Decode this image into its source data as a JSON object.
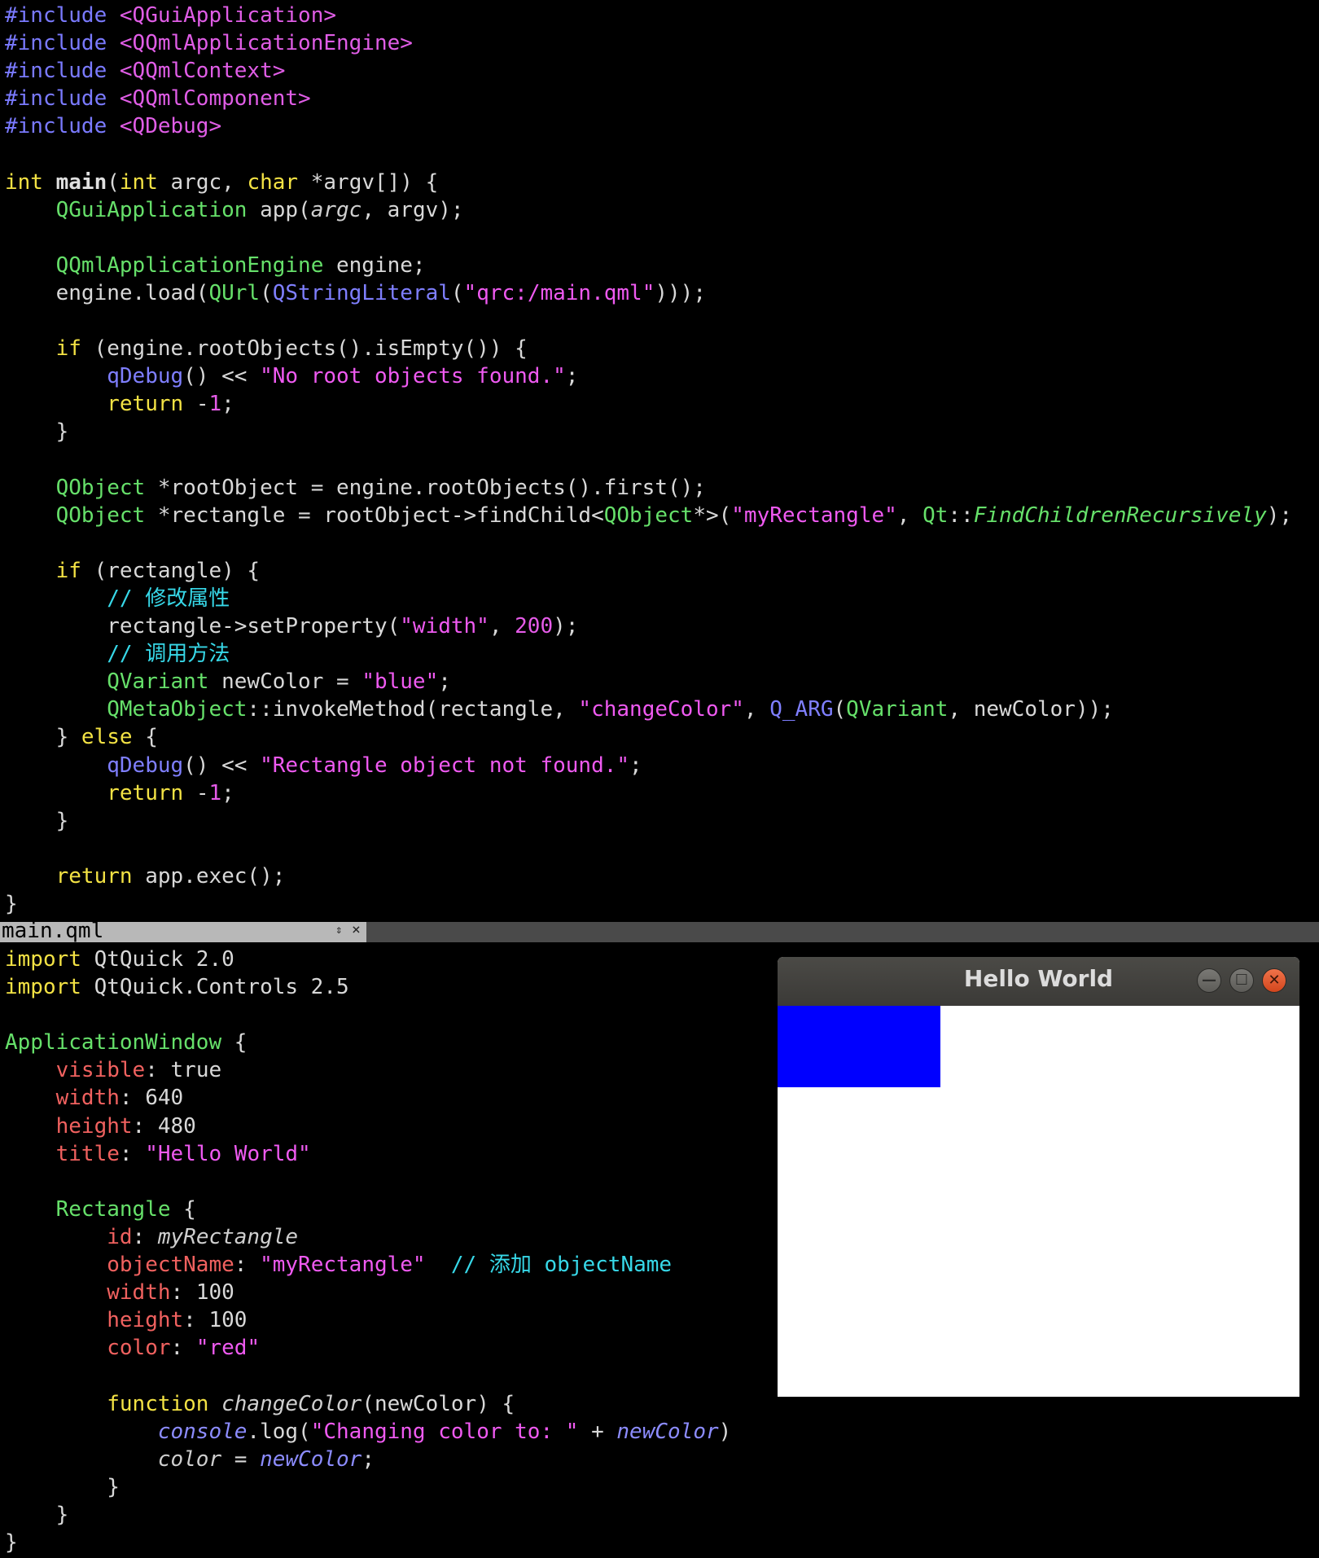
{
  "cpp_editor": {
    "lines": [
      [
        {
          "t": "#include ",
          "c": "macro"
        },
        {
          "t": "<QGuiApplication>",
          "c": "inc"
        }
      ],
      [
        {
          "t": "#include ",
          "c": "macro"
        },
        {
          "t": "<QQmlApplicationEngine>",
          "c": "inc"
        }
      ],
      [
        {
          "t": "#include ",
          "c": "macro"
        },
        {
          "t": "<QQmlContext>",
          "c": "inc"
        }
      ],
      [
        {
          "t": "#include ",
          "c": "macro"
        },
        {
          "t": "<QQmlComponent>",
          "c": "inc"
        }
      ],
      [
        {
          "t": "#include ",
          "c": "macro"
        },
        {
          "t": "<QDebug>",
          "c": "inc"
        }
      ],
      [],
      [
        {
          "t": "int ",
          "c": "kw"
        },
        {
          "t": "main",
          "c": "bold"
        },
        {
          "t": "(",
          "c": "plain"
        },
        {
          "t": "int ",
          "c": "kw"
        },
        {
          "t": "argc, ",
          "c": "plain"
        },
        {
          "t": "char ",
          "c": "kw"
        },
        {
          "t": "*argv[]) {",
          "c": "plain"
        }
      ],
      [
        {
          "t": "    ",
          "c": "plain"
        },
        {
          "t": "QGuiApplication ",
          "c": "type"
        },
        {
          "t": "app(",
          "c": "plain"
        },
        {
          "t": "argc",
          "c": "it"
        },
        {
          "t": ", argv);",
          "c": "plain"
        }
      ],
      [],
      [
        {
          "t": "    ",
          "c": "plain"
        },
        {
          "t": "QQmlApplicationEngine ",
          "c": "type"
        },
        {
          "t": "engine;",
          "c": "plain"
        }
      ],
      [
        {
          "t": "    engine.load(",
          "c": "plain"
        },
        {
          "t": "QUrl",
          "c": "type"
        },
        {
          "t": "(",
          "c": "plain"
        },
        {
          "t": "QStringLiteral",
          "c": "fnb"
        },
        {
          "t": "(",
          "c": "plain"
        },
        {
          "t": "\"qrc:/main.qml\"",
          "c": "str"
        },
        {
          "t": ")));",
          "c": "plain"
        }
      ],
      [],
      [
        {
          "t": "    ",
          "c": "plain"
        },
        {
          "t": "if ",
          "c": "kw"
        },
        {
          "t": "(engine.rootObjects().isEmpty()) {",
          "c": "plain"
        }
      ],
      [
        {
          "t": "        ",
          "c": "plain"
        },
        {
          "t": "qDebug",
          "c": "fnb"
        },
        {
          "t": "() << ",
          "c": "plain"
        },
        {
          "t": "\"No root objects found.\"",
          "c": "str"
        },
        {
          "t": ";",
          "c": "plain"
        }
      ],
      [
        {
          "t": "        ",
          "c": "plain"
        },
        {
          "t": "return ",
          "c": "kw"
        },
        {
          "t": "-",
          "c": "plain"
        },
        {
          "t": "1",
          "c": "num"
        },
        {
          "t": ";",
          "c": "plain"
        }
      ],
      [
        {
          "t": "    }",
          "c": "plain"
        }
      ],
      [],
      [
        {
          "t": "    ",
          "c": "plain"
        },
        {
          "t": "QObject ",
          "c": "type"
        },
        {
          "t": "*rootObject = engine.rootObjects().first();",
          "c": "plain"
        }
      ],
      [
        {
          "t": "    ",
          "c": "plain"
        },
        {
          "t": "QObject ",
          "c": "type"
        },
        {
          "t": "*rectangle = rootObject->findChild<",
          "c": "plain"
        },
        {
          "t": "QObject",
          "c": "type"
        },
        {
          "t": "*>(",
          "c": "plain"
        },
        {
          "t": "\"myRectangle\"",
          "c": "str"
        },
        {
          "t": ", ",
          "c": "plain"
        },
        {
          "t": "Qt",
          "c": "type"
        },
        {
          "t": "::",
          "c": "plain"
        },
        {
          "t": "FindChildrenRecursively",
          "c": "itg"
        },
        {
          "t": ");",
          "c": "plain"
        }
      ],
      [],
      [
        {
          "t": "    ",
          "c": "plain"
        },
        {
          "t": "if ",
          "c": "kw"
        },
        {
          "t": "(rectangle) {",
          "c": "plain"
        }
      ],
      [
        {
          "t": "        ",
          "c": "plain"
        },
        {
          "t": "// 修改属性",
          "c": "com"
        }
      ],
      [
        {
          "t": "        rectangle->setProperty(",
          "c": "plain"
        },
        {
          "t": "\"width\"",
          "c": "str"
        },
        {
          "t": ", ",
          "c": "plain"
        },
        {
          "t": "200",
          "c": "num"
        },
        {
          "t": ");",
          "c": "plain"
        }
      ],
      [
        {
          "t": "        ",
          "c": "plain"
        },
        {
          "t": "// 调用方法",
          "c": "com"
        }
      ],
      [
        {
          "t": "        ",
          "c": "plain"
        },
        {
          "t": "QVariant ",
          "c": "type"
        },
        {
          "t": "newColor = ",
          "c": "plain"
        },
        {
          "t": "\"blue\"",
          "c": "str"
        },
        {
          "t": ";",
          "c": "plain"
        }
      ],
      [
        {
          "t": "        ",
          "c": "plain"
        },
        {
          "t": "QMetaObject",
          "c": "type"
        },
        {
          "t": "::invokeMethod(rectangle, ",
          "c": "plain"
        },
        {
          "t": "\"changeColor\"",
          "c": "str"
        },
        {
          "t": ", ",
          "c": "plain"
        },
        {
          "t": "Q_ARG",
          "c": "fnb"
        },
        {
          "t": "(",
          "c": "plain"
        },
        {
          "t": "QVariant",
          "c": "type"
        },
        {
          "t": ", newColor));",
          "c": "plain"
        }
      ],
      [
        {
          "t": "    } ",
          "c": "plain"
        },
        {
          "t": "else ",
          "c": "kw"
        },
        {
          "t": "{",
          "c": "plain"
        }
      ],
      [
        {
          "t": "        ",
          "c": "plain"
        },
        {
          "t": "qDebug",
          "c": "fnb"
        },
        {
          "t": "() << ",
          "c": "plain"
        },
        {
          "t": "\"Rectangle object not found.\"",
          "c": "str"
        },
        {
          "t": ";",
          "c": "plain"
        }
      ],
      [
        {
          "t": "        ",
          "c": "plain"
        },
        {
          "t": "return ",
          "c": "kw"
        },
        {
          "t": "-",
          "c": "plain"
        },
        {
          "t": "1",
          "c": "num"
        },
        {
          "t": ";",
          "c": "plain"
        }
      ],
      [
        {
          "t": "    }",
          "c": "plain"
        }
      ],
      [],
      [
        {
          "t": "    ",
          "c": "plain"
        },
        {
          "t": "return ",
          "c": "kw"
        },
        {
          "t": "app.exec();",
          "c": "plain"
        }
      ],
      [
        {
          "t": "}",
          "c": "plain"
        }
      ]
    ]
  },
  "tab": {
    "filename": "main.qml",
    "scroll_icon": "⇕",
    "close_icon": "×"
  },
  "qml_editor": {
    "lines": [
      [
        {
          "t": "import ",
          "c": "kw"
        },
        {
          "t": "QtQuick 2.0",
          "c": "plain"
        }
      ],
      [
        {
          "t": "import ",
          "c": "kw"
        },
        {
          "t": "QtQuick.Controls 2.5",
          "c": "plain"
        }
      ],
      [],
      [
        {
          "t": "ApplicationWindow ",
          "c": "type"
        },
        {
          "t": "{",
          "c": "plain"
        }
      ],
      [
        {
          "t": "    ",
          "c": "plain"
        },
        {
          "t": "visible",
          "c": "prop"
        },
        {
          "t": ": true",
          "c": "plain"
        }
      ],
      [
        {
          "t": "    ",
          "c": "plain"
        },
        {
          "t": "width",
          "c": "prop"
        },
        {
          "t": ": 640",
          "c": "plain"
        }
      ],
      [
        {
          "t": "    ",
          "c": "plain"
        },
        {
          "t": "height",
          "c": "prop"
        },
        {
          "t": ": 480",
          "c": "plain"
        }
      ],
      [
        {
          "t": "    ",
          "c": "plain"
        },
        {
          "t": "title",
          "c": "prop"
        },
        {
          "t": ": ",
          "c": "plain"
        },
        {
          "t": "\"Hello World\"",
          "c": "str"
        }
      ],
      [],
      [
        {
          "t": "    ",
          "c": "plain"
        },
        {
          "t": "Rectangle ",
          "c": "type"
        },
        {
          "t": "{",
          "c": "plain"
        }
      ],
      [
        {
          "t": "        ",
          "c": "plain"
        },
        {
          "t": "id",
          "c": "prop"
        },
        {
          "t": ": ",
          "c": "plain"
        },
        {
          "t": "myRectangle",
          "c": "id"
        }
      ],
      [
        {
          "t": "        ",
          "c": "plain"
        },
        {
          "t": "objectName",
          "c": "prop"
        },
        {
          "t": ": ",
          "c": "plain"
        },
        {
          "t": "\"myRectangle\"",
          "c": "str"
        },
        {
          "t": "  ",
          "c": "plain"
        },
        {
          "t": "// 添加 objectName",
          "c": "com"
        }
      ],
      [
        {
          "t": "        ",
          "c": "plain"
        },
        {
          "t": "width",
          "c": "prop"
        },
        {
          "t": ": 100",
          "c": "plain"
        }
      ],
      [
        {
          "t": "        ",
          "c": "plain"
        },
        {
          "t": "height",
          "c": "prop"
        },
        {
          "t": ": 100",
          "c": "plain"
        }
      ],
      [
        {
          "t": "        ",
          "c": "plain"
        },
        {
          "t": "color",
          "c": "prop"
        },
        {
          "t": ": ",
          "c": "plain"
        },
        {
          "t": "\"red\"",
          "c": "str"
        }
      ],
      [],
      [
        {
          "t": "        ",
          "c": "plain"
        },
        {
          "t": "function ",
          "c": "kw"
        },
        {
          "t": "changeColor",
          "c": "it"
        },
        {
          "t": "(newColor) {",
          "c": "plain"
        }
      ],
      [
        {
          "t": "            ",
          "c": "plain"
        },
        {
          "t": "console",
          "c": "itb"
        },
        {
          "t": ".log(",
          "c": "plain"
        },
        {
          "t": "\"Changing color to: \"",
          "c": "str"
        },
        {
          "t": " + ",
          "c": "plain"
        },
        {
          "t": "newColor",
          "c": "itb"
        },
        {
          "t": ")",
          "c": "plain"
        }
      ],
      [
        {
          "t": "            ",
          "c": "plain"
        },
        {
          "t": "color",
          "c": "it"
        },
        {
          "t": " = ",
          "c": "plain"
        },
        {
          "t": "newColor",
          "c": "itb"
        },
        {
          "t": ";",
          "c": "plain"
        }
      ],
      [
        {
          "t": "        }",
          "c": "plain"
        }
      ],
      [
        {
          "t": "    }",
          "c": "plain"
        }
      ],
      [
        {
          "t": "}",
          "c": "plain"
        }
      ]
    ]
  },
  "app_window": {
    "title": "Hello World",
    "minimize_icon": "—",
    "maximize_icon": "☐",
    "close_icon": "✕",
    "rectangle_color": "#0000ff",
    "background_color": "#ffffff"
  },
  "colors": {
    "background": "#000000",
    "keyword": "#f3e244",
    "type": "#66e06a",
    "string": "#ef5af1",
    "comment": "#37d8e8",
    "property": "#f0615f",
    "macro": "#7a7aff"
  }
}
